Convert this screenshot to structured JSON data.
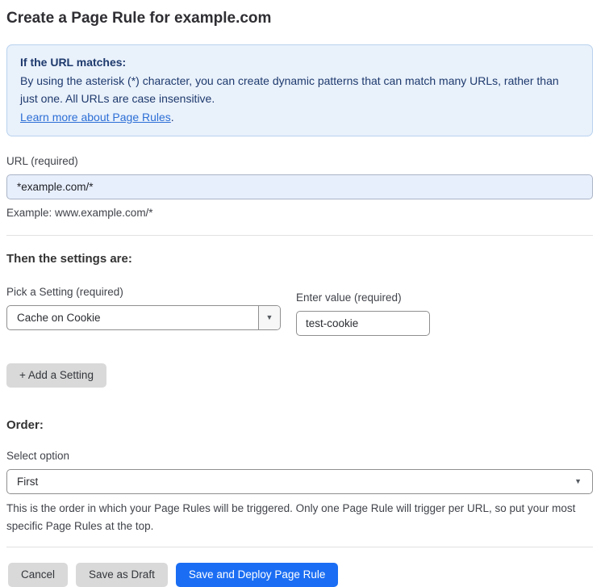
{
  "page": {
    "title": "Create a Page Rule for example.com"
  },
  "info_box": {
    "heading": "If the URL matches:",
    "body": "By using the asterisk (*) character, you can create dynamic patterns that can match many URLs, rather than just one. All URLs are case insensitive.",
    "link_label": "Learn more about Page Rules",
    "link_suffix": "."
  },
  "url_field": {
    "label": "URL (required)",
    "value": "*example.com/*",
    "example": "Example: www.example.com/*"
  },
  "settings": {
    "heading": "Then the settings are:",
    "pick_label": "Pick a Setting (required)",
    "pick_selected": "Cache on Cookie",
    "value_label": "Enter value (required)",
    "value": "test-cookie",
    "add_button_label": "+ Add a Setting"
  },
  "order": {
    "heading": "Order:",
    "select_label": "Select option",
    "selected": "First",
    "help_text": "This is the order in which your Page Rules will be triggered. Only one Page Rule will trigger per URL, so put your most specific Page Rules at the top."
  },
  "footer": {
    "cancel_label": "Cancel",
    "save_draft_label": "Save as Draft",
    "save_deploy_label": "Save and Deploy Page Rule"
  },
  "icons": {
    "dropdown_arrow": "▼"
  },
  "colors": {
    "primary_button_blue": "#1b6ef3",
    "info_box_background": "#e9f1fb",
    "info_box_border": "#b9d2ee",
    "info_text_navy": "#1e3a6d",
    "link_blue": "#2c6fd6",
    "url_input_background": "#e8effc",
    "gray_button": "#d9d9d9"
  }
}
